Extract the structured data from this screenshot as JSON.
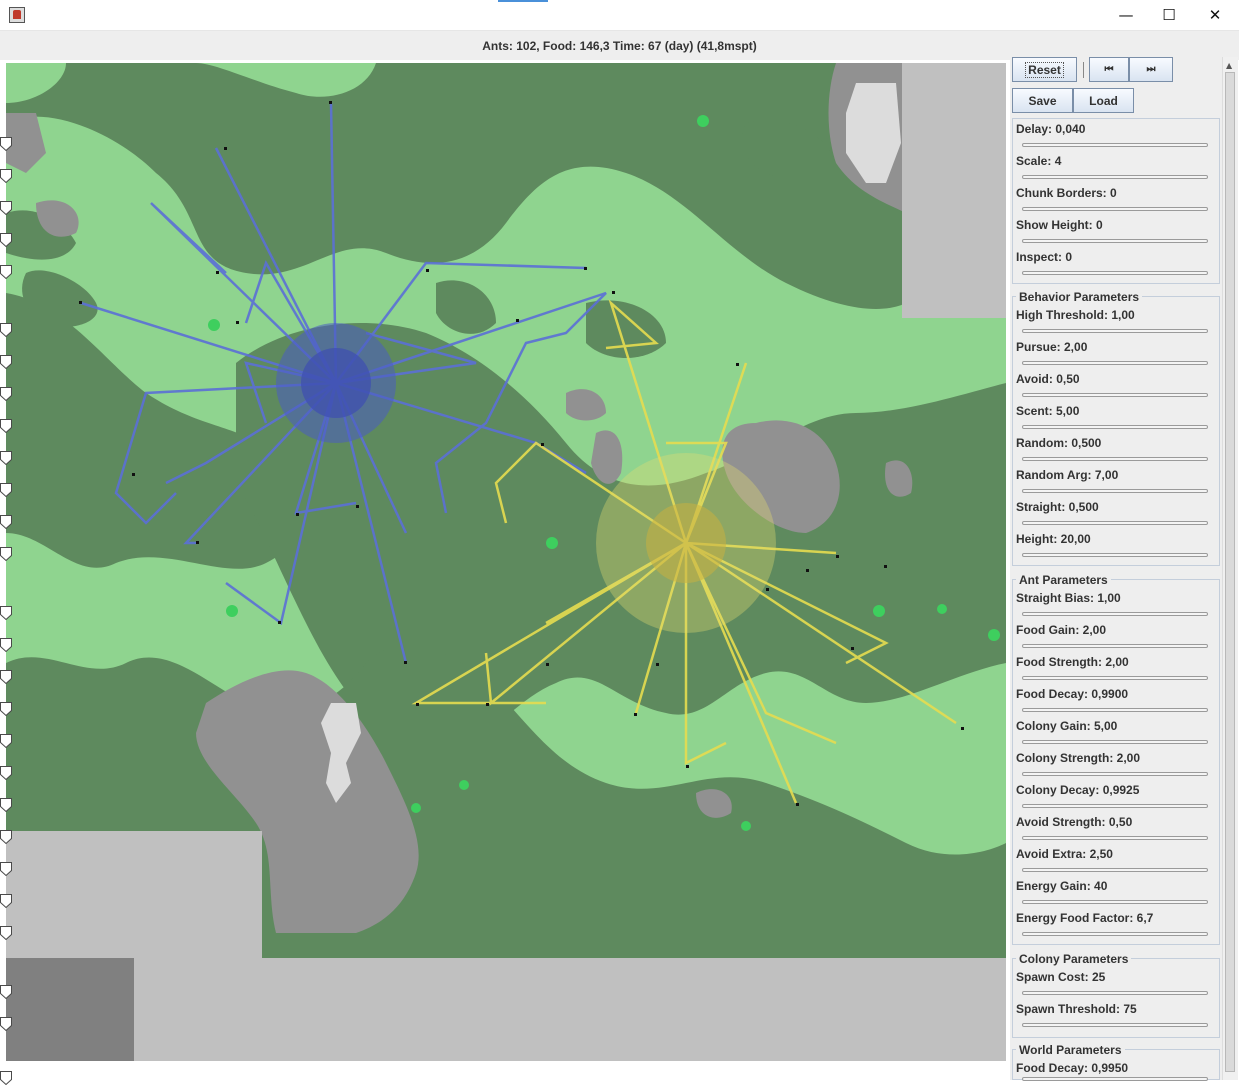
{
  "window": {
    "minimize": "—",
    "maximize": "☐",
    "close": "✕",
    "icon": "java-app-icon"
  },
  "status": {
    "text": "Ants: 102, Food: 146,3  Time: 67 (day) (41,8mspt)"
  },
  "toolbar": {
    "reset": "Reset",
    "step": "⏮",
    "fast_forward": "⏭",
    "save": "Save",
    "load": "Load"
  },
  "view": {
    "delay": "Delay: 0,040",
    "scale": "Scale: 4",
    "chunk_borders": "Chunk Borders: 0",
    "show_height": "Show Height: 0",
    "inspect": "Inspect: 0"
  },
  "behavior": {
    "title": "Behavior Parameters",
    "high_threshold": "High Threshold: 1,00",
    "pursue": "Pursue: 2,00",
    "avoid": "Avoid: 0,50",
    "scent": "Scent: 5,00",
    "random": "Random: 0,500",
    "random_arg": "Random Arg: 7,00",
    "straight": "Straight: 0,500",
    "height": "Height: 20,00"
  },
  "ant": {
    "title": "Ant Parameters",
    "straight_bias": "Straight Bias: 1,00",
    "food_gain": "Food Gain: 2,00",
    "food_strength": "Food Strength: 2,00",
    "food_decay": "Food Decay: 0,9900",
    "colony_gain": "Colony Gain: 5,00",
    "colony_strength": "Colony Strength: 2,00",
    "colony_decay": "Colony Decay: 0,9925",
    "avoid_strength": "Avoid Strength: 0,50",
    "avoid_extra": "Avoid Extra: 2,50",
    "energy_gain": "Energy Gain: 40",
    "energy_food_factor": "Energy Food Factor: 6,7"
  },
  "colony": {
    "title": "Colony Parameters",
    "spawn_cost": "Spawn Cost: 25",
    "spawn_threshold": "Spawn Threshold: 75"
  },
  "world": {
    "title": "World Parameters",
    "food_decay": "Food Decay: 0,9950"
  },
  "slider_levels": {
    "delay": 0.41,
    "scale": 0.44,
    "chunk_borders": 0.0,
    "show_height": 0.0,
    "inspect": 0.0,
    "high_threshold": 0.11,
    "pursue": 0.21,
    "avoid": 0.05,
    "scent": 0.51,
    "random": 0.51,
    "random_arg": 0.72,
    "straight": 0.26,
    "height": 0.21,
    "straight_bias": 0.11,
    "food_gain": 0.21,
    "food_strength": 0.21,
    "food_decay": 0.93,
    "colony_gain": 0.51,
    "colony_strength": 0.21,
    "colony_decay": 0.96,
    "avoid_strength": 0.05,
    "avoid_extra": 0.26,
    "energy_gain": 0.4,
    "energy_food_factor": 0.14,
    "spawn_cost": 0.25,
    "spawn_threshold": 0.38,
    "world_food_decay": 0.96
  },
  "colors": {
    "grass": "#8fd48f",
    "forest": "#5e8a5e",
    "rock": "#919191",
    "snow": "#dcdcdc",
    "void": "#c0c0c0",
    "dark_void": "#808080",
    "blue_colony": "#5b6fd6",
    "yellow_colony": "#e6dc50",
    "food": "#3ecf5e"
  }
}
